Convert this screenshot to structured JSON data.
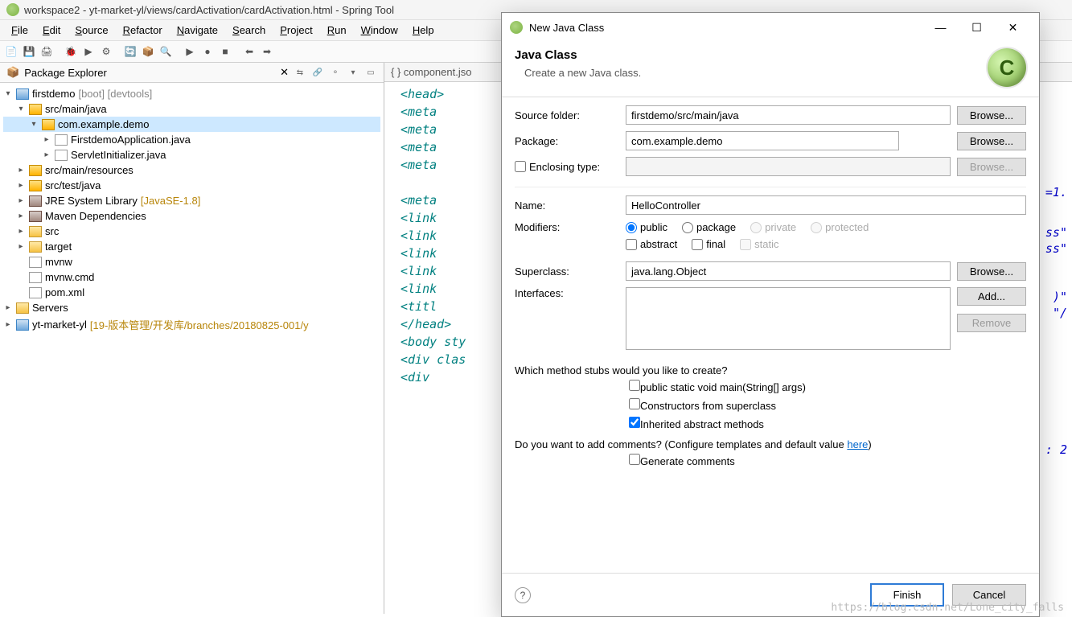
{
  "titlebar": "workspace2 - yt-market-yl/views/cardActivation/cardActivation.html - Spring Tool",
  "menubar": [
    "File",
    "Edit",
    "Source",
    "Refactor",
    "Navigate",
    "Search",
    "Project",
    "Run",
    "Window",
    "Help"
  ],
  "package_explorer": {
    "title": "Package Explorer",
    "tree": [
      {
        "indent": 0,
        "twisty": "▾",
        "icon": "prj",
        "label": "firstdemo",
        "suffix": " [boot] [devtools]",
        "sel": false
      },
      {
        "indent": 1,
        "twisty": "▾",
        "icon": "pkg",
        "label": "src/main/java"
      },
      {
        "indent": 2,
        "twisty": "▾",
        "icon": "pkg",
        "label": "com.example.demo",
        "sel": true
      },
      {
        "indent": 3,
        "twisty": "▸",
        "icon": "file",
        "label": "FirstdemoApplication.java"
      },
      {
        "indent": 3,
        "twisty": "▸",
        "icon": "file",
        "label": "ServletInitializer.java"
      },
      {
        "indent": 1,
        "twisty": "▸",
        "icon": "pkg",
        "label": "src/main/resources"
      },
      {
        "indent": 1,
        "twisty": "▸",
        "icon": "pkg",
        "label": "src/test/java"
      },
      {
        "indent": 1,
        "twisty": "▸",
        "icon": "jar",
        "label": "JRE System Library",
        "suffix": " [JavaSE-1.8]",
        "lib": true
      },
      {
        "indent": 1,
        "twisty": "▸",
        "icon": "jar",
        "label": "Maven Dependencies"
      },
      {
        "indent": 1,
        "twisty": "▸",
        "icon": "fold",
        "label": "src"
      },
      {
        "indent": 1,
        "twisty": "▸",
        "icon": "fold",
        "label": "target"
      },
      {
        "indent": 1,
        "twisty": "",
        "icon": "file",
        "label": "mvnw"
      },
      {
        "indent": 1,
        "twisty": "",
        "icon": "file",
        "label": "mvnw.cmd"
      },
      {
        "indent": 1,
        "twisty": "",
        "icon": "file",
        "label": "pom.xml"
      },
      {
        "indent": 0,
        "twisty": "▸",
        "icon": "fold",
        "label": "Servers"
      },
      {
        "indent": 0,
        "twisty": "▸",
        "icon": "prj",
        "label": "yt-market-yl",
        "suffix": " [19-版本管理/开发库/branches/20180825-001/y",
        "lib": true
      }
    ]
  },
  "editor": {
    "tab": "{ } component.jso",
    "lines": [
      "<head>",
      "  <meta",
      "  <meta",
      "  <meta",
      "  <meta",
      "",
      "  <meta",
      "  <link",
      "  <link",
      "  <link",
      "  <link",
      "  <link",
      "  <titl",
      "</head>",
      "<body sty",
      "<div clas",
      "  <div"
    ],
    "right_frag": [
      "=1.",
      "ss\"",
      "ss\"",
      ")\"",
      "\"/",
      ":  2"
    ]
  },
  "dialog": {
    "title": "New Java Class",
    "banner": {
      "heading": "Java Class",
      "sub": "Create a new Java class."
    },
    "labels": {
      "source_folder": "Source folder:",
      "package": "Package:",
      "enclosing": "Enclosing type:",
      "name": "Name:",
      "modifiers": "Modifiers:",
      "superclass": "Superclass:",
      "interfaces": "Interfaces:"
    },
    "values": {
      "source_folder": "firstdemo/src/main/java",
      "package": "com.example.demo",
      "enclosing": "",
      "name": "HelloController",
      "superclass": "java.lang.Object"
    },
    "buttons": {
      "browse": "Browse...",
      "add": "Add...",
      "remove": "Remove",
      "finish": "Finish",
      "cancel": "Cancel"
    },
    "modifiers": {
      "radios": [
        {
          "label": "public",
          "checked": true,
          "enabled": true
        },
        {
          "label": "package",
          "checked": false,
          "enabled": true
        },
        {
          "label": "private",
          "checked": false,
          "enabled": false
        },
        {
          "label": "protected",
          "checked": false,
          "enabled": false
        }
      ],
      "checks": [
        {
          "label": "abstract",
          "checked": false,
          "enabled": true
        },
        {
          "label": "final",
          "checked": false,
          "enabled": true
        },
        {
          "label": "static",
          "checked": false,
          "enabled": false
        }
      ]
    },
    "stubs": {
      "question": "Which method stubs would you like to create?",
      "items": [
        {
          "label": "public static void main(String[] args)",
          "checked": false
        },
        {
          "label": "Constructors from superclass",
          "checked": false
        },
        {
          "label": "Inherited abstract methods",
          "checked": true
        }
      ]
    },
    "comments": {
      "question_prefix": "Do you want to add comments? (Configure templates and default value ",
      "link": "here",
      "question_suffix": ")",
      "check": {
        "label": "Generate comments",
        "checked": false
      }
    }
  },
  "watermark": "https://blog.csdn.net/Lone_city_falls"
}
